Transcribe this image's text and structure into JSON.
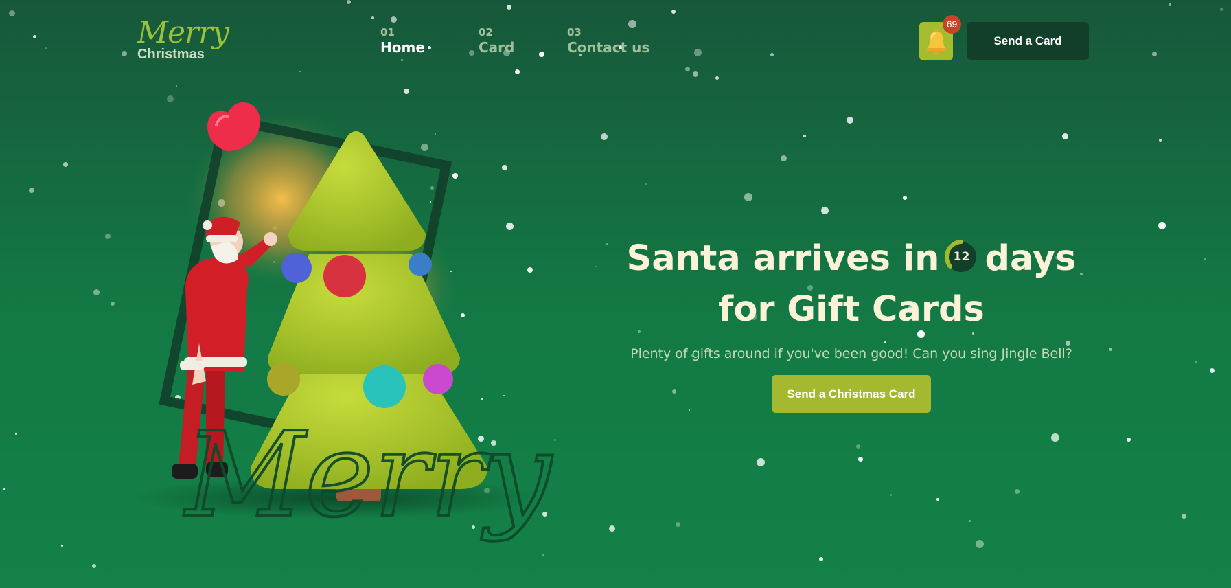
{
  "header": {
    "logo_script": "Merry",
    "logo_sub": "Christmas",
    "nav": [
      {
        "num": "01",
        "label": "Home",
        "active": true
      },
      {
        "num": "02",
        "label": "Card",
        "active": false
      },
      {
        "num": "03",
        "label": "Contact us",
        "active": false
      }
    ],
    "notification_count": "69",
    "send_card_label": "Send a Card"
  },
  "hero": {
    "headline_before": "Santa arrives in",
    "countdown_value": "12",
    "headline_after": "days",
    "headline_line2": "for Gift Cards",
    "subtext": "Plenty of gifts around if you've been good! Can you sing Jingle Bell?",
    "cta_label": "Send a Christmas Card",
    "illustration_script": "Merry"
  },
  "icons": {
    "bell": "bell-icon",
    "heart": "heart-icon",
    "santa": "santa-figure",
    "tree": "christmas-tree"
  },
  "colors": {
    "background": "#137a45",
    "accent_green": "#a4b92f",
    "dark_green": "#123f2a",
    "cream_text": "#fbf3d8",
    "badge_red": "#c6452a"
  }
}
